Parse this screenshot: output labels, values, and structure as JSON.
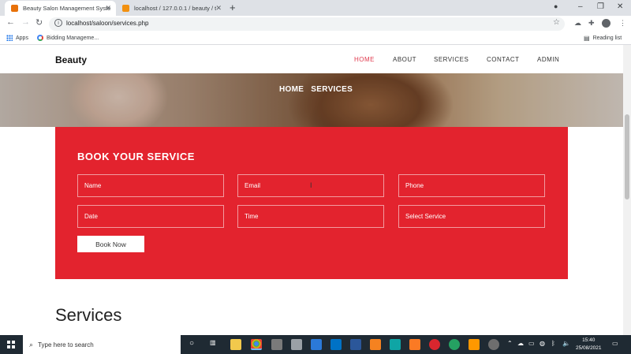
{
  "browser": {
    "tabs": [
      {
        "title": "Beauty Salon Management Syste",
        "active": true,
        "favicon_color": "#e8710a"
      },
      {
        "title": "localhost / 127.0.0.1 / beauty / t",
        "active": false,
        "favicon_color": "#f29111"
      }
    ],
    "url": "localhost/saloon/services.php",
    "bookmarks": [
      {
        "label": "Apps",
        "icon": "apps-grid-icon"
      },
      {
        "label": "Bidding Manageme...",
        "icon": "google-icon"
      }
    ],
    "reading_list_label": "Reading list"
  },
  "site": {
    "brand": "Beauty",
    "menu": [
      "HOME",
      "ABOUT",
      "SERVICES",
      "CONTACT",
      "ADMIN"
    ],
    "active_menu": "HOME",
    "accent_color": "#e03a4e"
  },
  "hero": {
    "breadcrumb": [
      "HOME",
      "SERVICES"
    ]
  },
  "booking": {
    "title": "BOOK YOUR SERVICE",
    "background_color": "#e3232e",
    "fields": {
      "name": "Name",
      "email": "Email",
      "phone": "Phone",
      "date": "Date",
      "time": "Time",
      "service": "Select Service"
    },
    "submit_label": "Book Now"
  },
  "services": {
    "heading": "Services"
  },
  "taskbar": {
    "search_placeholder": "Type here to search",
    "time": "15:40",
    "date": "25/08/2021"
  }
}
